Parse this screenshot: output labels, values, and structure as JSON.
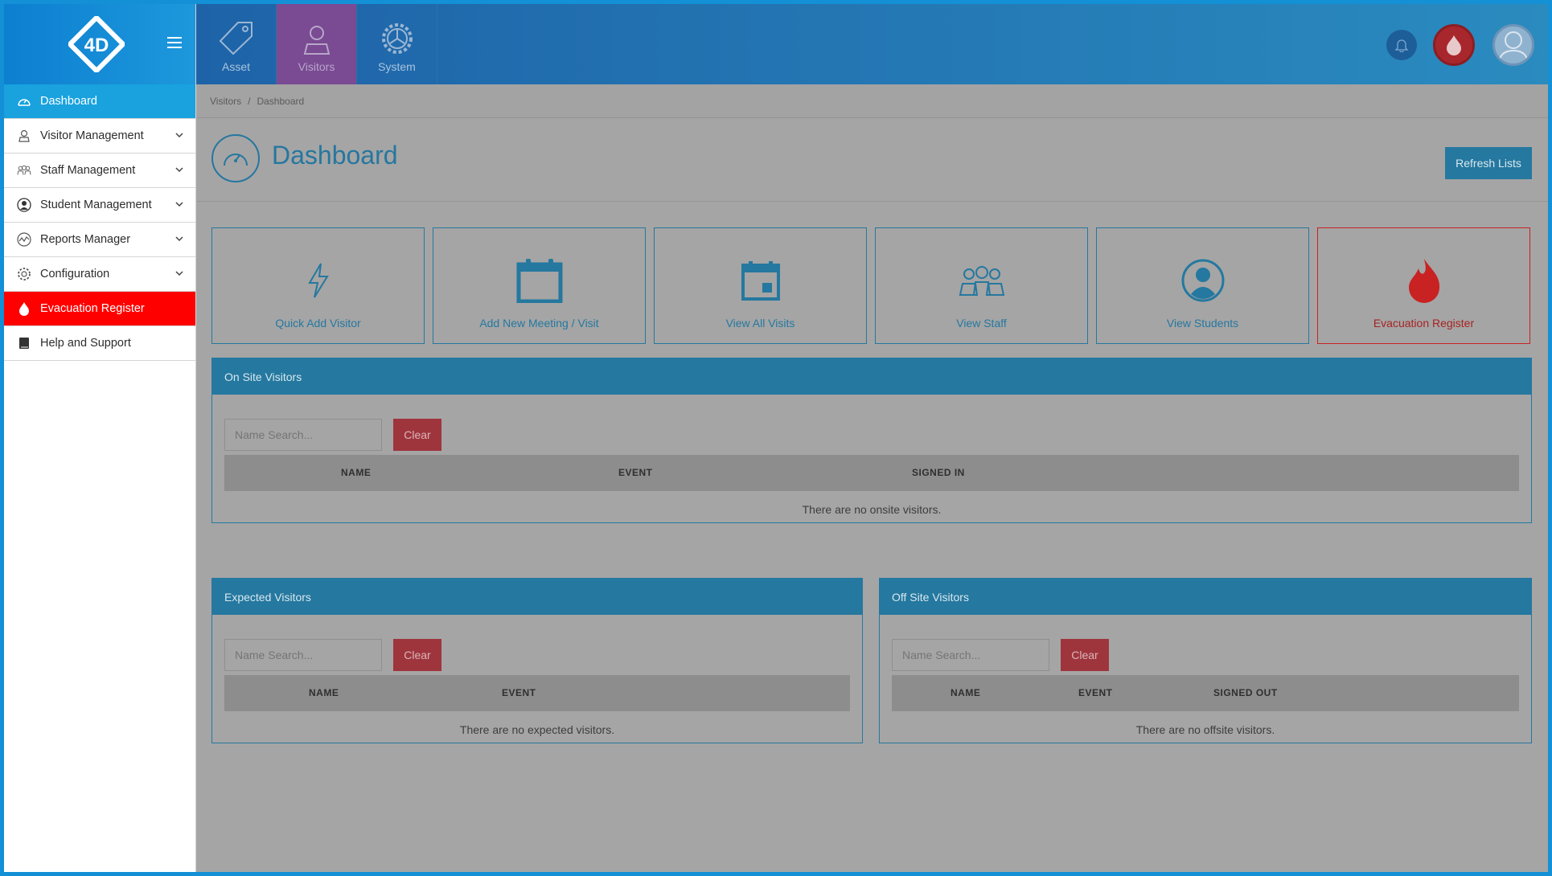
{
  "sidebar": {
    "items": [
      {
        "label": "Dashboard"
      },
      {
        "label": "Visitor Management"
      },
      {
        "label": "Staff Management"
      },
      {
        "label": "Student Management"
      },
      {
        "label": "Reports Manager"
      },
      {
        "label": "Configuration"
      },
      {
        "label": "Evacuation Register"
      },
      {
        "label": "Help and Support"
      }
    ]
  },
  "topbar": {
    "tabs": [
      {
        "label": "Asset"
      },
      {
        "label": "Visitors"
      },
      {
        "label": "System"
      }
    ]
  },
  "breadcrumb": {
    "root": "Visitors",
    "separator": "/",
    "current": "Dashboard"
  },
  "header": {
    "title": "Dashboard",
    "refresh_label": "Refresh Lists"
  },
  "tiles": [
    {
      "label": "Quick Add Visitor",
      "icon": "lightning-icon"
    },
    {
      "label": "Add New Meeting / Visit",
      "icon": "calendar-add-icon"
    },
    {
      "label": "View All Visits",
      "icon": "calendar-icon"
    },
    {
      "label": "View Staff",
      "icon": "staff-group-icon"
    },
    {
      "label": "View Students",
      "icon": "student-icon"
    },
    {
      "label": "Evacuation Register",
      "icon": "fire-icon"
    }
  ],
  "onsite": {
    "title": "On Site Visitors",
    "search_placeholder": "Name Search...",
    "clear_label": "Clear",
    "columns": [
      "NAME",
      "EVENT",
      "SIGNED IN"
    ],
    "empty": "There are no onsite visitors."
  },
  "expected": {
    "title": "Expected Visitors",
    "search_placeholder": "Name Search...",
    "clear_label": "Clear",
    "columns": [
      "NAME",
      "EVENT"
    ],
    "empty": "There are no expected visitors."
  },
  "offsite": {
    "title": "Off Site Visitors",
    "search_placeholder": "Name Search...",
    "clear_label": "Clear",
    "columns": [
      "NAME",
      "EVENT",
      "SIGNED OUT"
    ],
    "empty": "There are no offsite visitors."
  },
  "colors": {
    "accent": "#25789f",
    "evacuation": "#ff0000",
    "active_tab": "#7a4a93"
  }
}
